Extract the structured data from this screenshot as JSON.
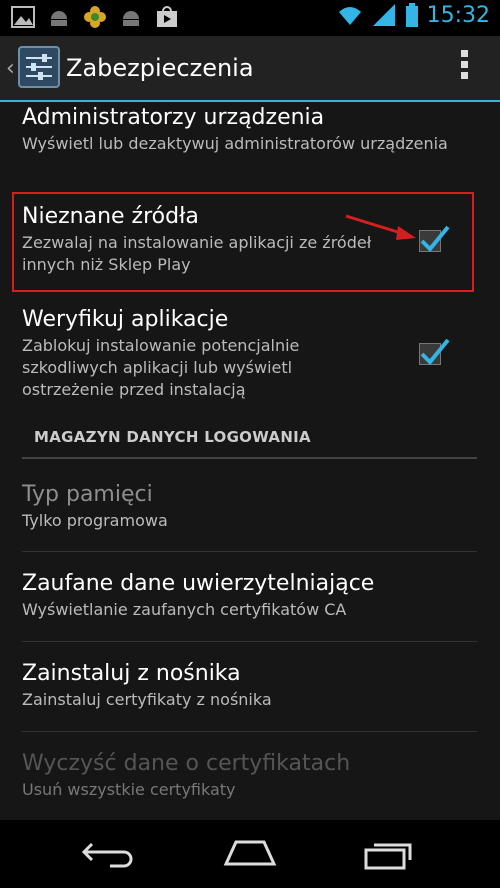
{
  "status_bar": {
    "time": "15:32",
    "left_icons": [
      "image-icon",
      "android-icon",
      "flower-icon",
      "android-icon",
      "play-store-icon"
    ],
    "right_icons": [
      "wifi-icon",
      "signal-icon",
      "battery-icon"
    ]
  },
  "action_bar": {
    "title": "Zabezpieczenia"
  },
  "settings": {
    "device_admins": {
      "title": "Administratorzy urządzenia",
      "summary": "Wyświetl lub dezaktywuj administratorów urządzenia"
    },
    "unknown_sources": {
      "title": "Nieznane źródła",
      "summary": "Zezwalaj na instalowanie aplikacji ze źródeł innych niż Sklep Play",
      "checked": true
    },
    "verify_apps": {
      "title": "Weryfikuj aplikacje",
      "summary": "Zablokuj instalowanie potencjalnie szkodliwych aplikacji lub wyświetl ostrzeżenie przed instalacją",
      "checked": true
    }
  },
  "section": {
    "header": "MAGAZYN DANYCH LOGOWANIA"
  },
  "credential_storage": {
    "storage_type": {
      "title": "Typ pamięci",
      "summary": "Tylko programowa"
    },
    "trusted_credentials": {
      "title": "Zaufane dane uwierzytelniające",
      "summary": "Wyświetlanie zaufanych certyfikatów CA"
    },
    "install_from_storage": {
      "title": "Zainstaluj z nośnika",
      "summary": "Zainstaluj certyfikaty z nośnika"
    },
    "clear_credentials": {
      "title": "Wyczyść dane o certyfikatach",
      "summary": "Usuń wszystkie certyfikaty"
    }
  },
  "nav_bar": {
    "icons": [
      "back-icon",
      "home-icon",
      "recent-apps-icon"
    ]
  },
  "colors": {
    "accent": "#33b5e5",
    "annotation": "#d21f1f"
  }
}
